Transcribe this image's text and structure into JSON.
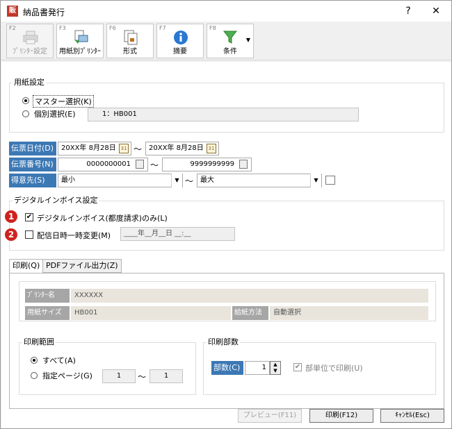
{
  "window": {
    "title": "納品書発行",
    "app_icon": "販",
    "help": "?",
    "close": "✕"
  },
  "toolbar": [
    {
      "fkey": "F2",
      "label": "ﾌﾟﾘﾝﾀｰ設定",
      "icon": "printer-icon"
    },
    {
      "fkey": "F3",
      "label": "用紙別ﾌﾟﾘﾝﾀｰ",
      "icon": "printer-paper-icon"
    },
    {
      "fkey": "F6",
      "label": "形式",
      "icon": "format-icon"
    },
    {
      "fkey": "F7",
      "label": "摘要",
      "icon": "info-icon"
    },
    {
      "fkey": "F8",
      "label": "条件",
      "icon": "filter-icon"
    }
  ],
  "paper": {
    "title": "用紙設定",
    "master": "マスター選択(K)",
    "individual": "個別選択(E)",
    "individual_value": "1：HB001"
  },
  "range": {
    "date_label": "伝票日付(D)",
    "date_from": "20XX年 8月28日",
    "date_to": "20XX年 8月28日",
    "no_label": "伝票番号(N)",
    "no_from": "0000000001",
    "no_to": "9999999999",
    "cust_label": "得意先(S)",
    "cust_from": "最小",
    "cust_to": "最大",
    "tilde": "〜"
  },
  "digital": {
    "title": "デジタルインボイス設定",
    "badge1": "1",
    "badge2": "2",
    "only_label": "デジタルインボイス(都度請求)のみ(L)",
    "change_label": "配信日時一時変更(M)",
    "change_value": "____年__月__日 __:__"
  },
  "tabs": {
    "print": "印刷(Q)",
    "pdf": "PDFファイル出力(Z)"
  },
  "printer": {
    "name_label": "ﾌﾟﾘﾝﾀｰ名",
    "name_value": "XXXXXX",
    "paper_label": "用紙サイズ",
    "paper_value": "HB001",
    "feed_label": "給紙方法",
    "feed_value": "自動選択"
  },
  "print_range": {
    "title": "印刷範囲",
    "all": "すべて(A)",
    "pages": "指定ページ(G)",
    "from": "1",
    "to": "1",
    "tilde": "〜"
  },
  "copies": {
    "title": "印刷部数",
    "label": "部数(C)",
    "value": "1",
    "per_unit": "部単位で印刷(U)"
  },
  "buttons": {
    "preview": "プレビュー(F11)",
    "print": "印刷(F12)",
    "cancel": "ｷｬﾝｾﾙ(Esc)"
  },
  "colors": {
    "accent": "#3c78b4",
    "badge": "#d0221d"
  }
}
